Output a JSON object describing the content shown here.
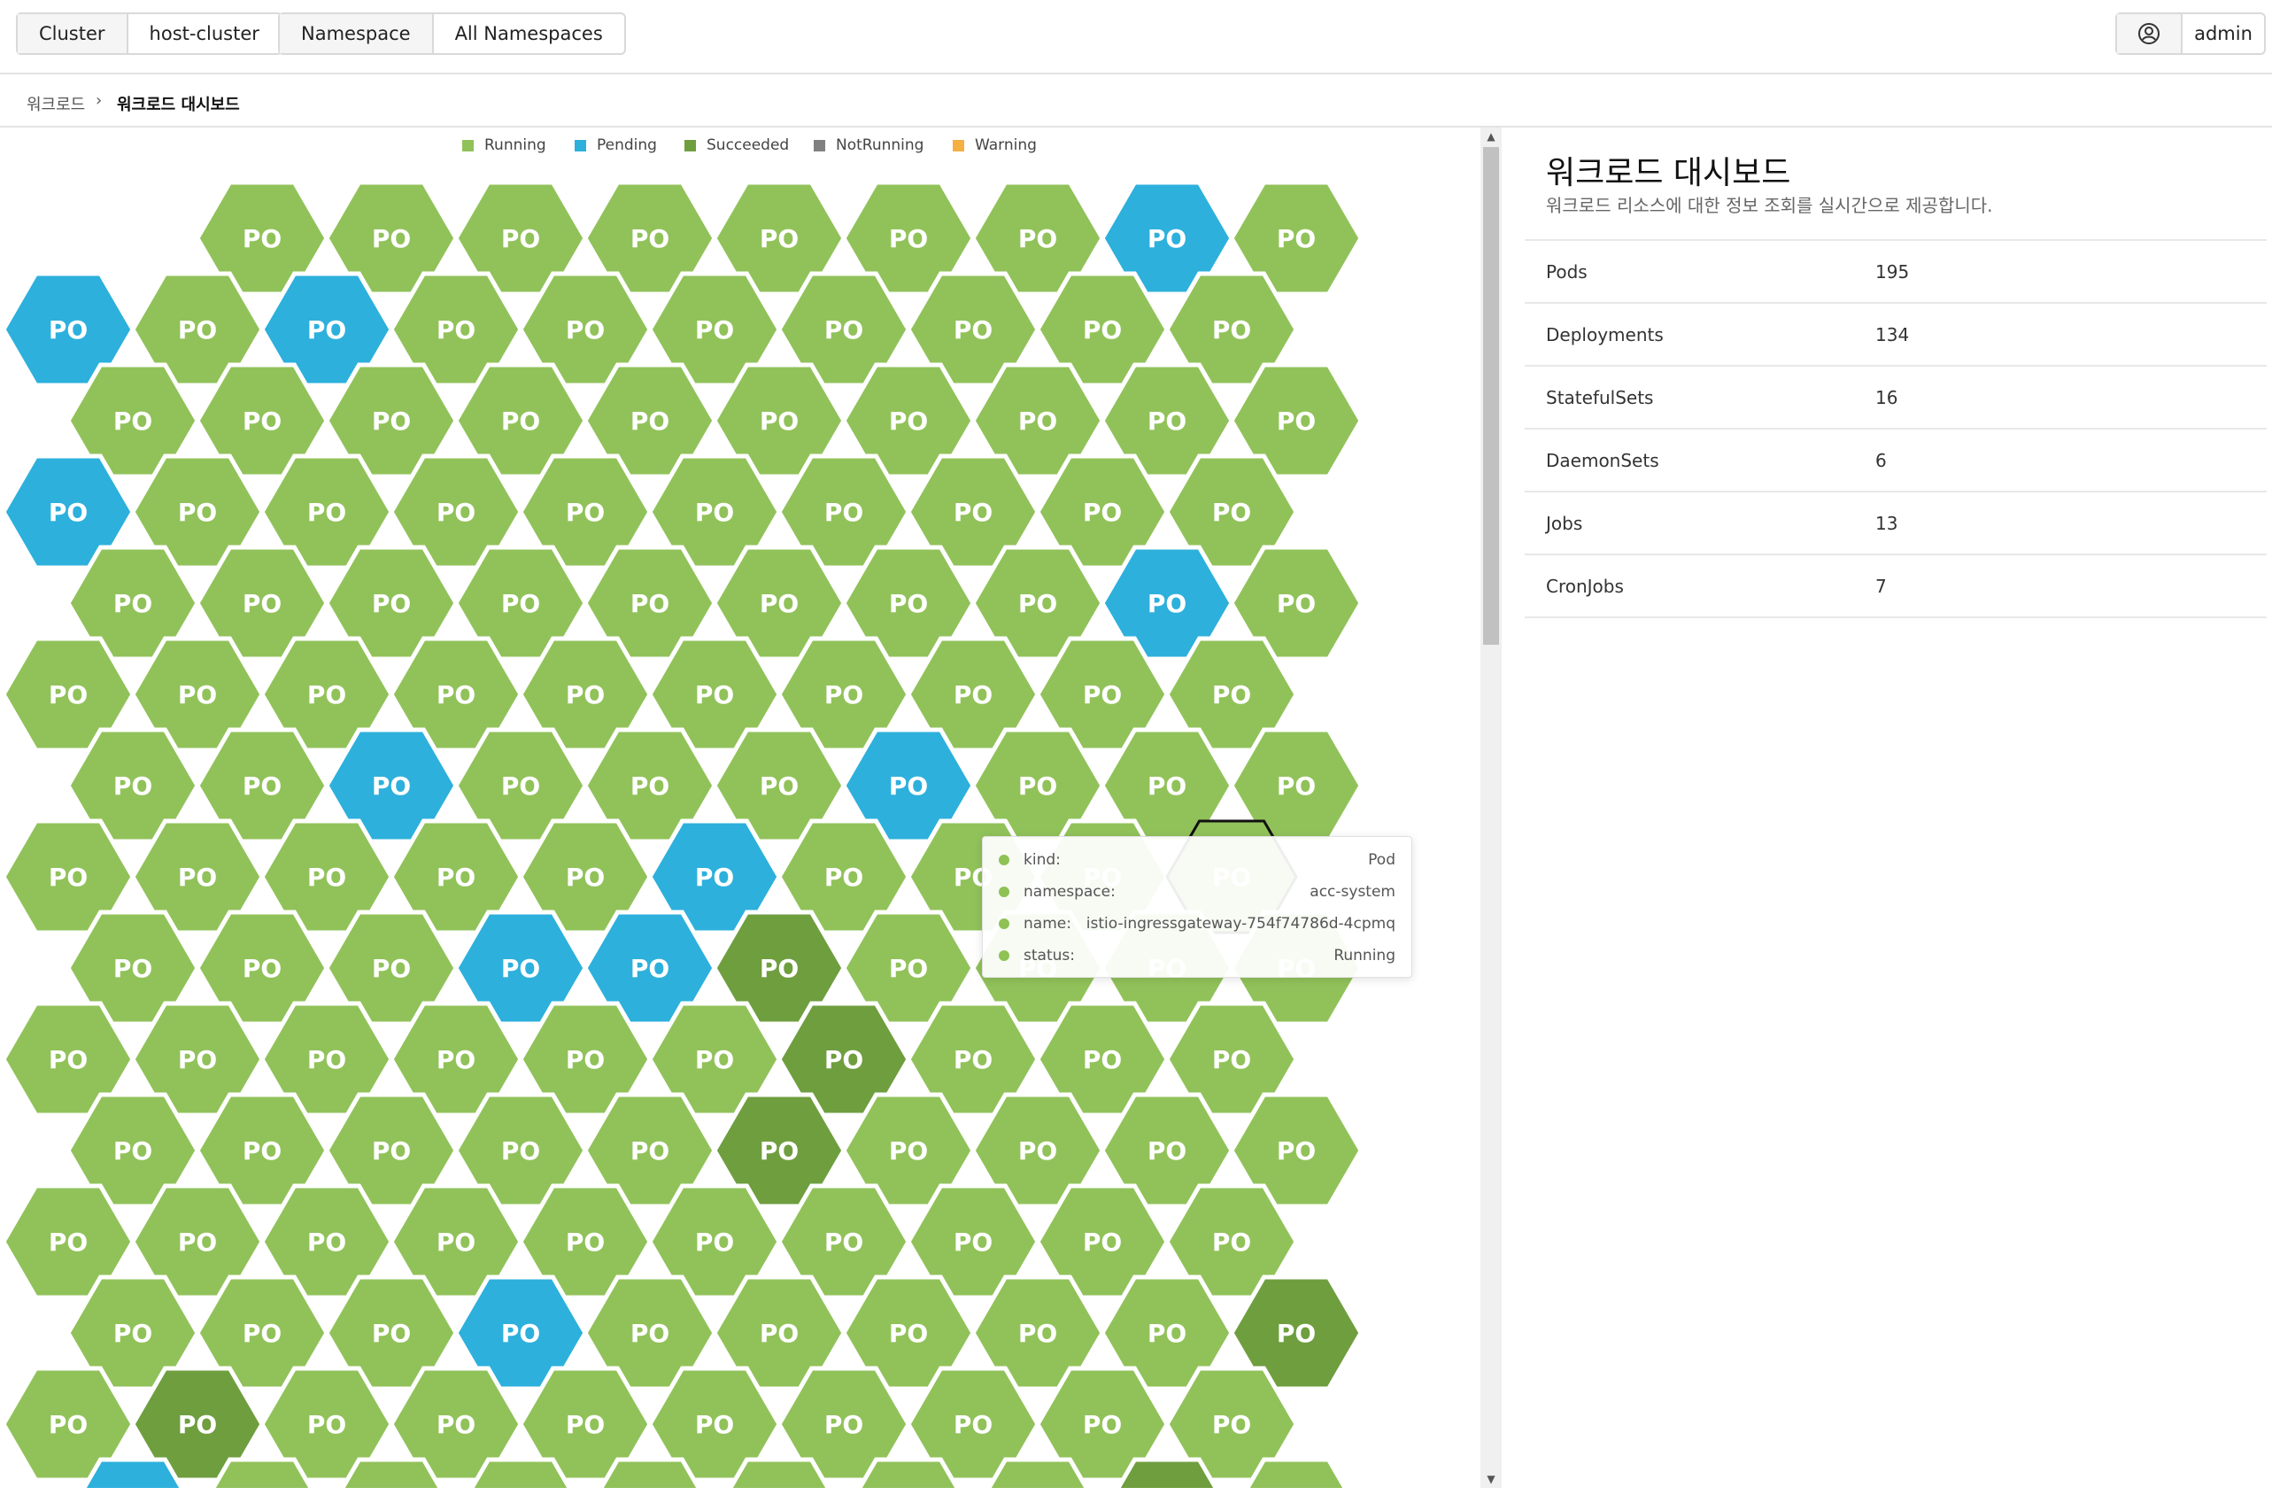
{
  "header": {
    "cluster": {
      "label": "Cluster",
      "value": "host-cluster"
    },
    "namespace": {
      "label": "Namespace",
      "value": "All Namespaces"
    },
    "user": {
      "name": "admin",
      "icon": "user-circle-icon"
    }
  },
  "breadcrumb": {
    "parent": "워크로드",
    "current": "워크로드 대시보드",
    "separator_icon": "chevron-right-icon"
  },
  "legend": [
    {
      "label": "Running",
      "color": "#91c25a"
    },
    {
      "label": "Pending",
      "color": "#2db0dc"
    },
    {
      "label": "Succeeded",
      "color": "#6f9e3f"
    },
    {
      "label": "NotRunning",
      "color": "#808080"
    },
    {
      "label": "Warning",
      "color": "#f5b041"
    }
  ],
  "hex_grid": {
    "cell_label": "PO",
    "rows": [
      "_RRRRRRRPR",
      "PRPRRRRRRR",
      "RRRRRRRRRR",
      "PRRRRRRRRR",
      "RRRRRRRRPR",
      "RRRRRRRRRR",
      "RRPRRRPRRR",
      "RRRRRPRRRR",
      "RRRPPSRRRR",
      "RRRRRRSRRR",
      "RRRRRSRRRR",
      "RRRRRRRRRR",
      "RRRPRRRRRS",
      "RSRRRRRRRR",
      "PRRRRRRRSR"
    ],
    "status_colors": {
      "R": "#91c25a",
      "P": "#2db0dc",
      "S": "#6f9e3f"
    },
    "highlighted": {
      "row": 7,
      "col": 9
    }
  },
  "tooltip": {
    "rows": [
      {
        "key": "kind:",
        "value": "Pod"
      },
      {
        "key": "namespace:",
        "value": "acc-system"
      },
      {
        "key": "name:",
        "value": "istio-ingressgateway-754f74786d-4cpmq"
      },
      {
        "key": "status:",
        "value": "Running"
      }
    ]
  },
  "info_panel": {
    "title": "워크로드 대시보드",
    "subtitle": "워크로드 리소스에 대한 정보 조회를 실시간으로 제공합니다.",
    "stats": [
      {
        "name": "Pods",
        "count": "195"
      },
      {
        "name": "Deployments",
        "count": "134"
      },
      {
        "name": "StatefulSets",
        "count": "16"
      },
      {
        "name": "DaemonSets",
        "count": "6"
      },
      {
        "name": "Jobs",
        "count": "13"
      },
      {
        "name": "CronJobs",
        "count": "7"
      }
    ]
  }
}
